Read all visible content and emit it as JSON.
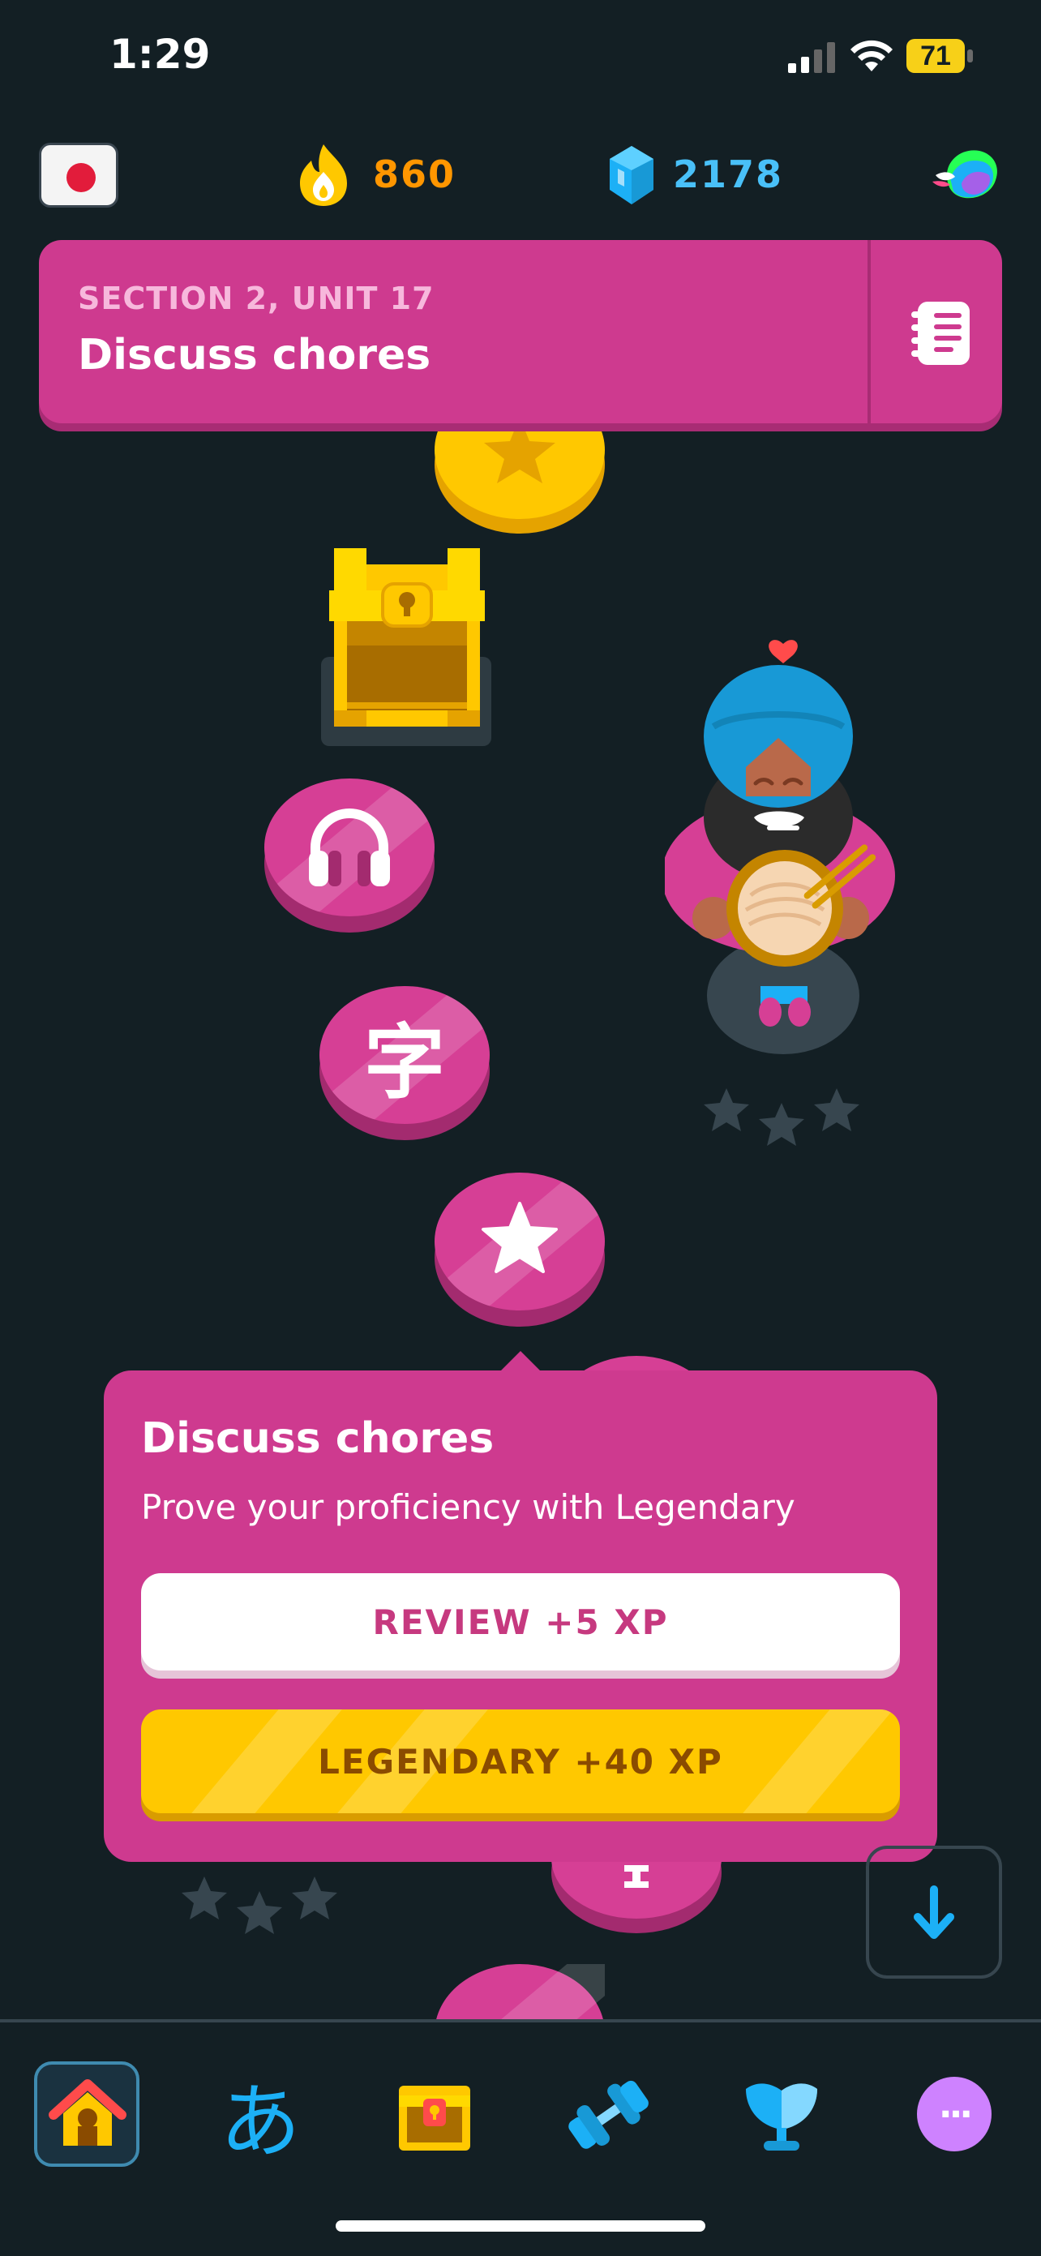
{
  "status": {
    "time": "1:29",
    "battery": "71"
  },
  "stats": {
    "streak": "860",
    "gems": "2178"
  },
  "banner": {
    "subtitle": "SECTION 2, UNIT 17",
    "title": "Discuss chores"
  },
  "nodes": {
    "kanji_label": "字"
  },
  "popup": {
    "title": "Discuss chores",
    "description": "Prove your proficiency with Legendary",
    "review_label": "REVIEW +5 XP",
    "legendary_label": "LEGENDARY +40 XP"
  },
  "nav": {
    "items": [
      "home-icon",
      "characters-icon",
      "leaderboard-chest-icon",
      "practice-dumbbell-icon",
      "league-trophy-icon",
      "more-icon"
    ],
    "characters_glyph": "あ",
    "more_glyph": "···"
  },
  "colors": {
    "background": "#131f24",
    "unit_pink": "#ce3a8f",
    "streak_orange": "#ff9600",
    "gem_blue": "#1cb0f6",
    "legendary_gold": "#ffc800"
  }
}
